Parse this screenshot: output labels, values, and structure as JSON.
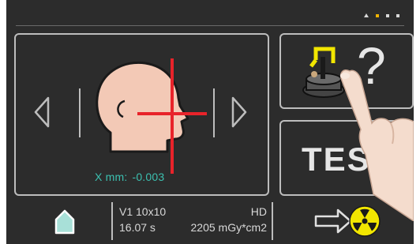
{
  "status": {
    "pages": [
      "up",
      "active",
      "page",
      "page"
    ]
  },
  "main": {
    "position_label": "X mm:",
    "position_value": "-0.003",
    "prev_icon": "chevron-left-icon",
    "next_icon": "chevron-right-icon",
    "head_icon": "patient-head-profile-icon",
    "crosshair_color": "#e8232a"
  },
  "help": {
    "icon": "device-help-icon",
    "question": "?"
  },
  "test": {
    "label": "TES"
  },
  "bottom": {
    "home_icon": "home-icon",
    "program": "V1 10x10",
    "quality": "HD",
    "time": "16.07 s",
    "dose": "2205 mGy*cm2",
    "expose_icon": "radiation-arrow-icon"
  },
  "colors": {
    "accent": "#3cc0b0",
    "active_page": "#f0b400",
    "radiation": "#f2e600",
    "skin": "#f3c9b6"
  }
}
